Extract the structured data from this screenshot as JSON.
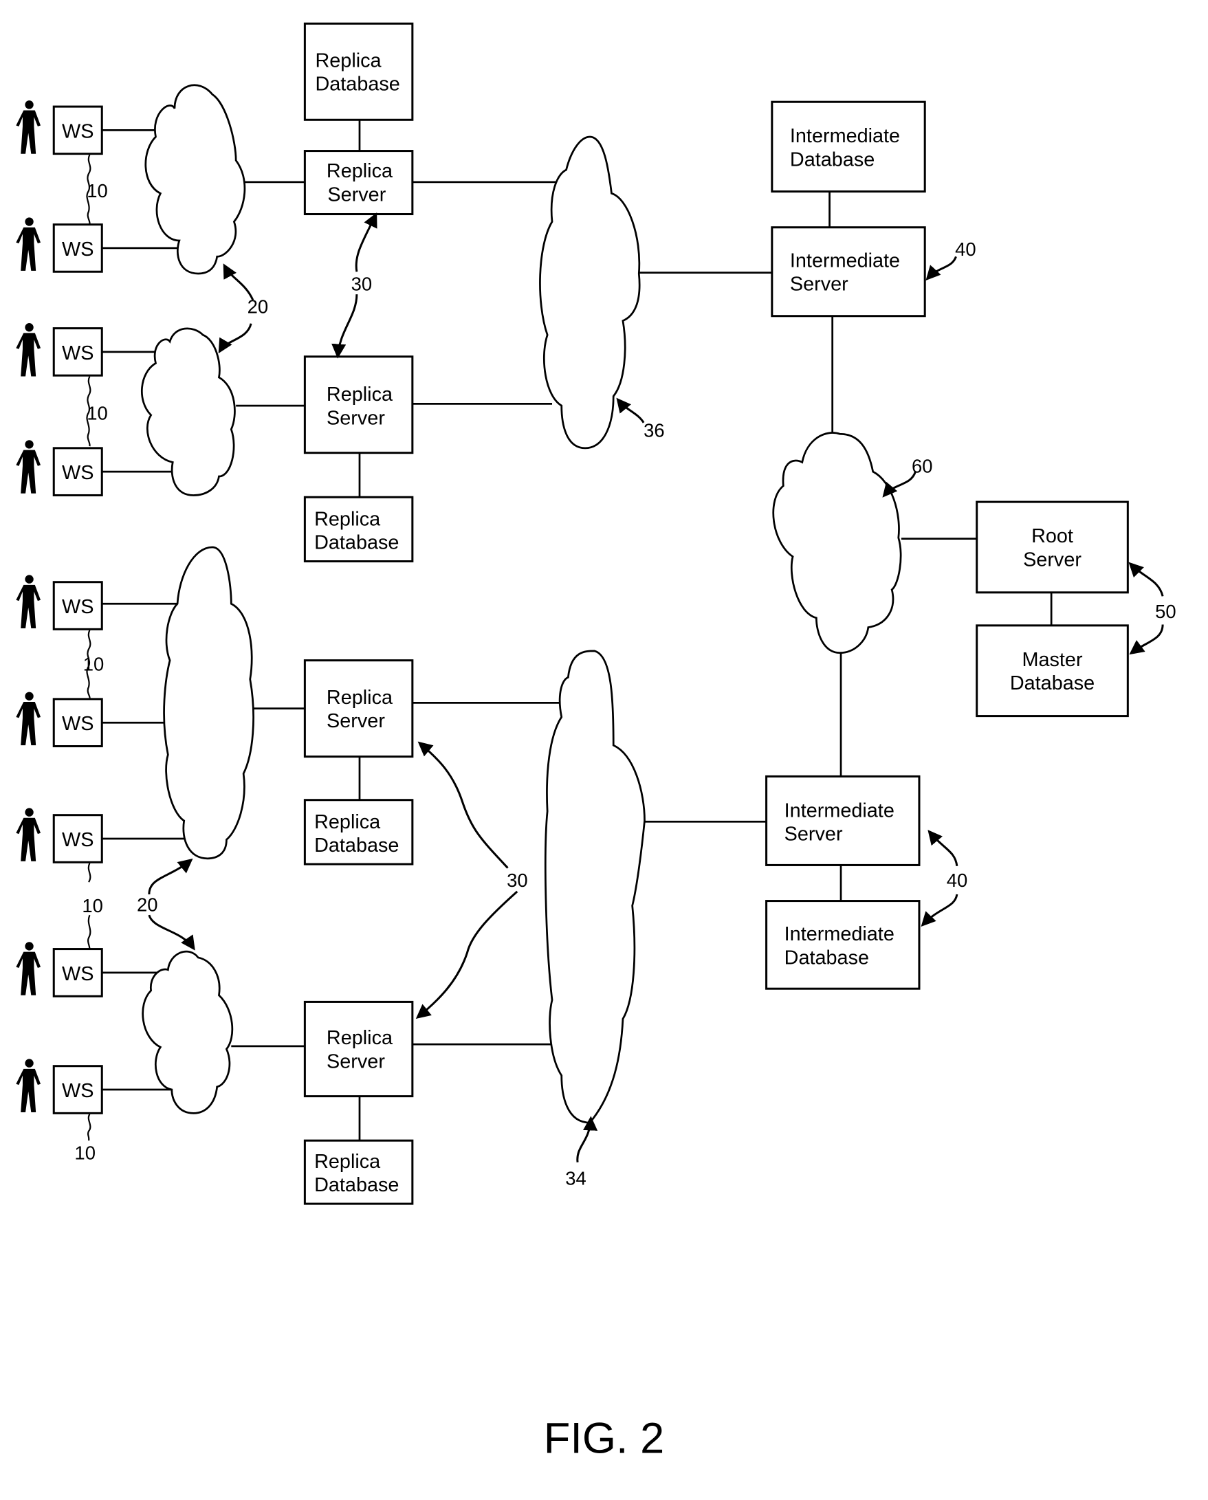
{
  "figure": {
    "caption": "FIG. 2"
  },
  "workstations": [
    {
      "label": "WS",
      "user_icon": "person-icon"
    },
    {
      "label": "WS",
      "user_icon": "person-icon"
    },
    {
      "label": "WS",
      "user_icon": "person-icon"
    },
    {
      "label": "WS",
      "user_icon": "person-icon"
    },
    {
      "label": "WS",
      "user_icon": "person-icon"
    },
    {
      "label": "WS",
      "user_icon": "person-icon"
    },
    {
      "label": "WS",
      "user_icon": "person-icon"
    },
    {
      "label": "WS",
      "user_icon": "person-icon"
    },
    {
      "label": "WS",
      "user_icon": "person-icon"
    }
  ],
  "replica_servers": [
    {
      "line1": "Replica",
      "line2": "Server"
    },
    {
      "line1": "Replica",
      "line2": "Server"
    },
    {
      "line1": "Replica",
      "line2": "Server"
    },
    {
      "line1": "Replica",
      "line2": "Server"
    }
  ],
  "replica_databases": [
    {
      "line1": "Replica",
      "line2": "Database"
    },
    {
      "line1": "Replica",
      "line2": "Database"
    },
    {
      "line1": "Replica",
      "line2": "Database"
    },
    {
      "line1": "Replica",
      "line2": "Database"
    }
  ],
  "intermediate_servers": [
    {
      "line1": "Intermediate",
      "line2": "Server"
    },
    {
      "line1": "Intermediate",
      "line2": "Server"
    }
  ],
  "intermediate_databases": [
    {
      "line1": "Intermediate",
      "line2": "Database"
    },
    {
      "line1": "Intermediate",
      "line2": "Database"
    }
  ],
  "root_server": {
    "line1": "Root",
    "line2": "Server"
  },
  "master_database": {
    "line1": "Master",
    "line2": "Database"
  },
  "reference_numerals": {
    "workstation": "10",
    "local_network": "20",
    "replica_server": "30",
    "wide_network_lower": "34",
    "wide_network_upper": "36",
    "intermediate": "40",
    "root": "50",
    "root_network": "60"
  }
}
